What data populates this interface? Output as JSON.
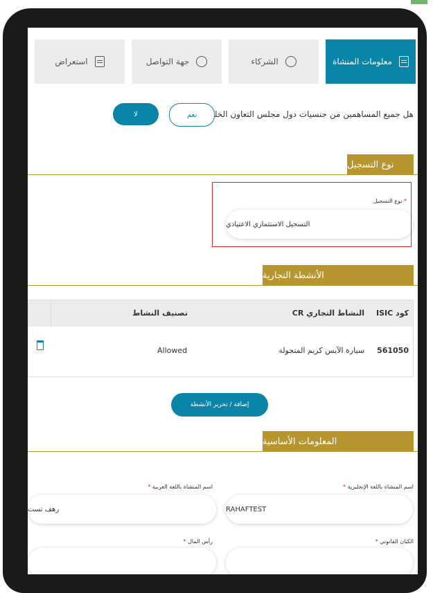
{
  "tabs": [
    {
      "label": "معلومات المنشاة",
      "icon": "document-icon"
    },
    {
      "label": "الشركاء",
      "icon": "partners-icon"
    },
    {
      "label": "جهة التواصل",
      "icon": "contact-icon"
    },
    {
      "label": "استعراض",
      "icon": "review-icon"
    }
  ],
  "gcc_question": "هل جميع المساهمين من جنسيات دول مجلس التعاون الخليجي؟",
  "yes_label": "نعم",
  "no_label": "لا",
  "registration_section": "نوع التسجيل",
  "registration_field_label": "نوع التسجيل",
  "registration_value": "التسجيل الاستثماري الاعتيادي",
  "activities_section": "الأنشطة التجارية",
  "table_headers": {
    "isic": "كود ISIC",
    "activity": "النشاط التجاري CR",
    "classification": "تصنيف النشاط"
  },
  "row": {
    "isic": "561050",
    "activity": "سيارة الآيس كريم المتجولة",
    "classification": "Allowed"
  },
  "add_button": "إضافة / تحرير الأنشطة",
  "basic_info_section": "المعلومات الأساسية",
  "name_en_label": "اسم المنشاة باللغة الإنجليزية",
  "name_en_value": "RAHAFTEST",
  "name_ar_label": "اسم المنشاة باللغة العربية",
  "name_ar_value": "رهف تست",
  "legal_entity_label": "الكيان القانوني",
  "capital_label": "رأس المال",
  "required_mark": "*",
  "colors": {
    "primary": "#0a84a8",
    "gold": "#b8962f",
    "highlight": "#d8262c"
  }
}
